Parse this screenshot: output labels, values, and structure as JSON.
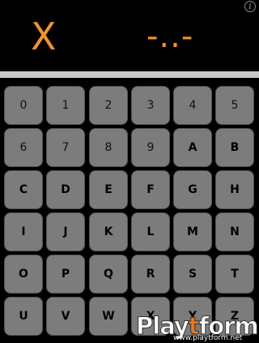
{
  "display": {
    "left_value": "X",
    "right_value": "-..-",
    "accent_color": "#f0922e",
    "info_icon": "info-icon"
  },
  "keypad": {
    "rows": [
      [
        "0",
        "1",
        "2",
        "3",
        "4",
        "5"
      ],
      [
        "6",
        "7",
        "8",
        "9",
        "A",
        "B"
      ],
      [
        "C",
        "D",
        "E",
        "F",
        "G",
        "H"
      ],
      [
        "I",
        "J",
        "K",
        "L",
        "M",
        "N"
      ],
      [
        "O",
        "P",
        "Q",
        "R",
        "S",
        "T"
      ],
      [
        "U",
        "V",
        "W",
        "X",
        "Y",
        "Z"
      ]
    ]
  },
  "watermark": {
    "logo_text_a": "Play",
    "logo_text_t": "t",
    "logo_text_b": "form",
    "url": "www.playtform.net"
  }
}
